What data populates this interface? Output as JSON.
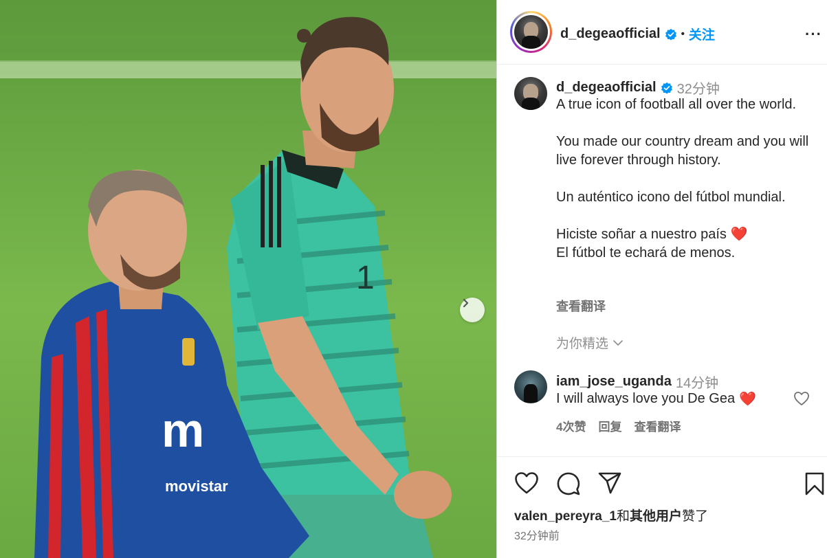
{
  "post": {
    "username": "d_degeaofficial",
    "follow_label": "关注",
    "separator": "•",
    "more_label": "···"
  },
  "caption": {
    "username": "d_degeaofficial",
    "time": "32分钟",
    "text": "A true icon of football all over the world.\n\nYou made our country dream and you will live forever through history.\n\nUn auténtico icono del fútbol mundial.\n\nHiciste soñar a nuestro país",
    "text_tail": "El fútbol te echará de menos.",
    "heart": "❤️",
    "translate_label": "查看翻译"
  },
  "for_you_label": "为你精选",
  "comment": {
    "username": "iam_jose_uganda",
    "time": "14分钟",
    "text": "I will always love you De Gea",
    "heart": "❤️",
    "likes": "4次赞",
    "reply_label": "回复",
    "translate_label": "查看翻译"
  },
  "likes_line": {
    "user": "valen_pereyra_1",
    "connector": "和",
    "others": "其他用户",
    "suffix": "赞了"
  },
  "post_time": "32分钟前",
  "colors": {
    "follow_blue": "#0095f6",
    "verified_blue": "#0095f6",
    "heart_red": "#ed1c24",
    "muted": "#8e8e8e"
  },
  "icons": [
    "verified-icon",
    "more-icon",
    "next-arrow-icon",
    "heart-icon",
    "comment-icon",
    "share-icon",
    "save-icon",
    "chevron-down-icon"
  ]
}
